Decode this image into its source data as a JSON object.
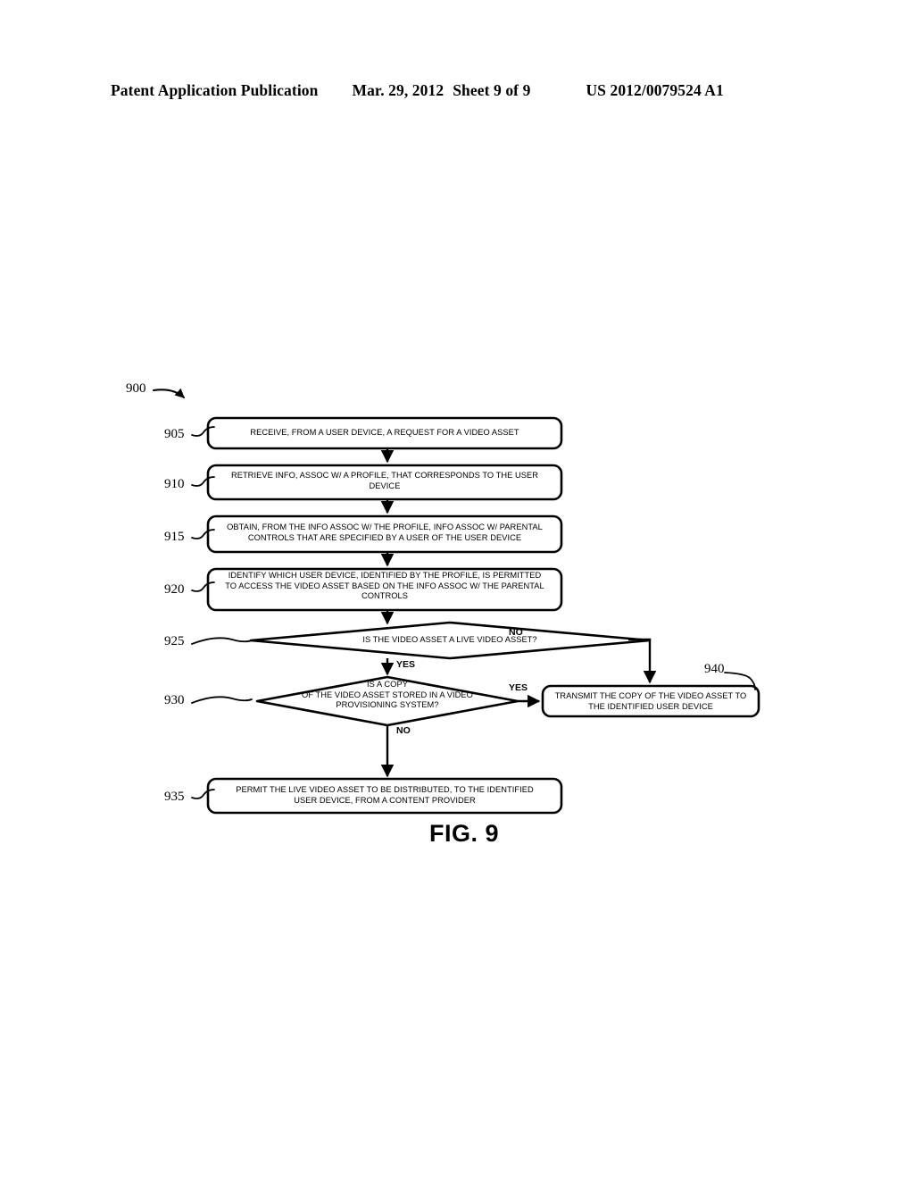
{
  "header": {
    "publication": "Patent Application Publication",
    "date": "Mar. 29, 2012",
    "sheet": "Sheet 9 of 9",
    "patent_number": "US 2012/0079524 A1"
  },
  "figure": {
    "caption": "FIG. 9",
    "diagram_ref": "900",
    "nodes": [
      {
        "ref": "905",
        "type": "process",
        "lines": [
          "RECEIVE, FROM A USER DEVICE, A REQUEST FOR A VIDEO ASSET"
        ]
      },
      {
        "ref": "910",
        "type": "process",
        "lines": [
          "RETRIEVE INFO, ASSOC W/ A PROFILE, THAT CORRESPONDS TO THE USER",
          "DEVICE"
        ]
      },
      {
        "ref": "915",
        "type": "process",
        "lines": [
          "OBTAIN, FROM THE INFO ASSOC W/ THE PROFILE, INFO ASSOC W/ PARENTAL",
          "CONTROLS THAT ARE SPECIFIED BY A USER OF THE USER DEVICE"
        ]
      },
      {
        "ref": "920",
        "type": "process",
        "lines": [
          "IDENTIFY WHICH USER DEVICE, IDENTIFIED BY THE PROFILE, IS PERMITTED",
          "TO ACCESS THE VIDEO ASSET BASED ON THE INFO ASSOC W/ THE PARENTAL",
          "CONTROLS"
        ]
      },
      {
        "ref": "925",
        "type": "decision",
        "lines": [
          "IS THE VIDEO ASSET A LIVE VIDEO ASSET?"
        ]
      },
      {
        "ref": "930",
        "type": "decision",
        "lines": [
          "IS A COPY",
          "OF THE VIDEO ASSET STORED IN A VIDEO",
          "PROVISIONING SYSTEM?"
        ]
      },
      {
        "ref": "935",
        "type": "process",
        "lines": [
          "PERMIT THE LIVE VIDEO ASSET TO BE DISTRIBUTED, TO THE IDENTIFIED",
          "USER DEVICE, FROM A CONTENT PROVIDER"
        ]
      },
      {
        "ref": "940",
        "type": "process",
        "lines": [
          "TRANSMIT THE COPY OF THE VIDEO ASSET TO",
          "THE IDENTIFIED USER DEVICE"
        ]
      }
    ],
    "branch_labels": {
      "d925_no": "NO",
      "d925_yes": "YES",
      "d930_yes": "YES",
      "d930_no": "NO"
    }
  },
  "colors": {
    "ink": "#000000",
    "paper": "#ffffff"
  }
}
